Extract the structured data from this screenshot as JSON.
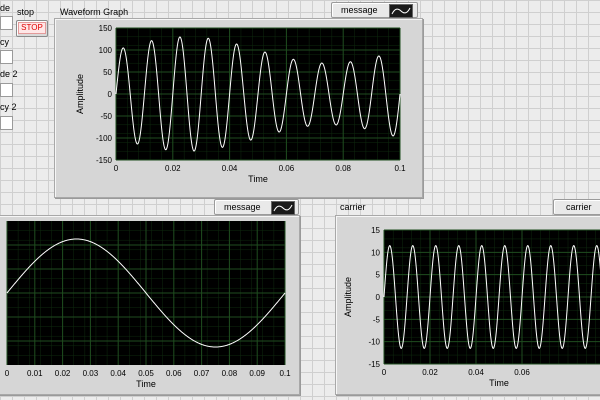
{
  "controls": {
    "amplitude_label": "de",
    "frequency_label": "cy",
    "amplitude2_label": "de 2",
    "frequency2_label": "cy 2",
    "stop_label": "stop",
    "stop_button_text": "STOP"
  },
  "graphs": {
    "waveform": {
      "title": "Waveform Graph",
      "legend_label": "message"
    },
    "message": {
      "legend_label": "message"
    },
    "carrier": {
      "title": "carrier",
      "legend_label": "carrier"
    }
  },
  "colors": {
    "plot_bg": "#000000",
    "grid": "#1f4d1f",
    "trace": "#ffffff",
    "stop_text": "#e00000"
  },
  "chart_data": [
    {
      "id": "waveform",
      "type": "line",
      "title": "Waveform Graph",
      "xlabel": "Time",
      "ylabel": "Amplitude",
      "xlim": [
        0,
        0.1
      ],
      "ylim": [
        -150,
        150
      ],
      "xticks": [
        "0",
        "0.02",
        "0.04",
        "0.06",
        "0.08",
        "0.1"
      ],
      "yticks": [
        "150",
        "100",
        "50",
        "0",
        "-50",
        "-100",
        "-150"
      ],
      "signal": {
        "kind": "am",
        "carrier_amplitude": 100,
        "carrier_freq": 100,
        "message_amplitude": 30,
        "message_freq": 10
      }
    },
    {
      "id": "message",
      "type": "line",
      "xlabel": "Time",
      "xlim": [
        0,
        0.1
      ],
      "ylim": [
        -1,
        1
      ],
      "xticks": [
        "0",
        "0.01",
        "0.02",
        "0.03",
        "0.04",
        "0.05",
        "0.06",
        "0.07",
        "0.08",
        "0.09",
        "0.1"
      ],
      "signal": {
        "kind": "sine",
        "amplitude": 0.75,
        "freq": 10
      }
    },
    {
      "id": "carrier",
      "type": "line",
      "title": "carrier",
      "xlabel": "Time",
      "ylabel": "Amplitude",
      "xlim": [
        0,
        0.1
      ],
      "ylim": [
        -15,
        15
      ],
      "xticks": [
        "0",
        "0.02",
        "0.04",
        "0.06"
      ],
      "yticks": [
        "15",
        "10",
        "5",
        "0",
        "-5",
        "-10",
        "-15"
      ],
      "signal": {
        "kind": "sine",
        "amplitude": 11.5,
        "freq": 100
      }
    }
  ]
}
